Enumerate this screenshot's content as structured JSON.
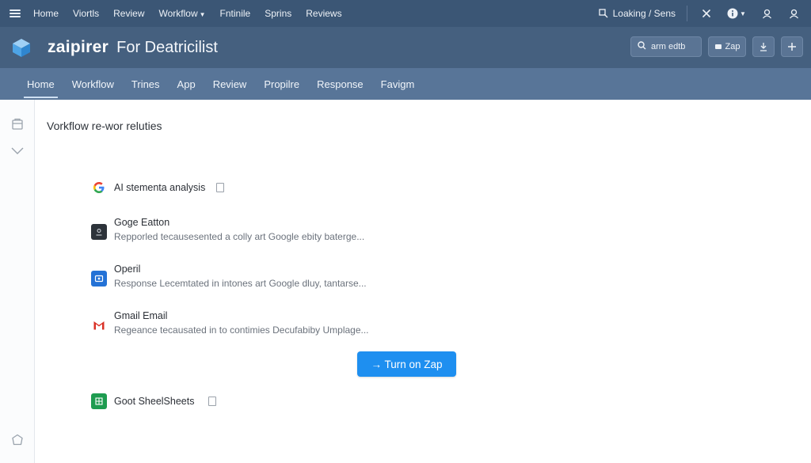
{
  "topbar": {
    "menu": [
      "Home",
      "Viortls",
      "Review",
      "Workflow",
      "Fntinile",
      "Sprins",
      "Reviews"
    ],
    "loading_label": "Loaking / Sens"
  },
  "header": {
    "brand": "zaipirer",
    "subtitle": "For Deatricilist",
    "search_placeholder": "arm edtb",
    "zap_label": "Zap"
  },
  "tabs": [
    "Home",
    "Workflow",
    "Trines",
    "App",
    "Review",
    "Propilre",
    "Response",
    "Favigm"
  ],
  "main": {
    "section_title": "Vorkflow re-wor reluties",
    "steps": [
      {
        "name": "AI stementa analysis",
        "desc": ""
      },
      {
        "name": "Goge Eatton",
        "desc": "Repporled tecausesented a colly art Google ebity batergе..."
      },
      {
        "name": "Operil",
        "desc": "Response Lecemtated in intones art Google dluy, tantarse..."
      },
      {
        "name": "Gmail Email",
        "desc": "Regeance tecausated in to contimies Decufabiby Umplage..."
      },
      {
        "name": "Goot SheelSheets",
        "desc": ""
      }
    ],
    "primary_button": "→ Turn on Zap"
  },
  "colors": {
    "topbar": "#3b5675",
    "header": "#45607f",
    "tabbar": "#587598",
    "primary": "#1e8ff0"
  }
}
